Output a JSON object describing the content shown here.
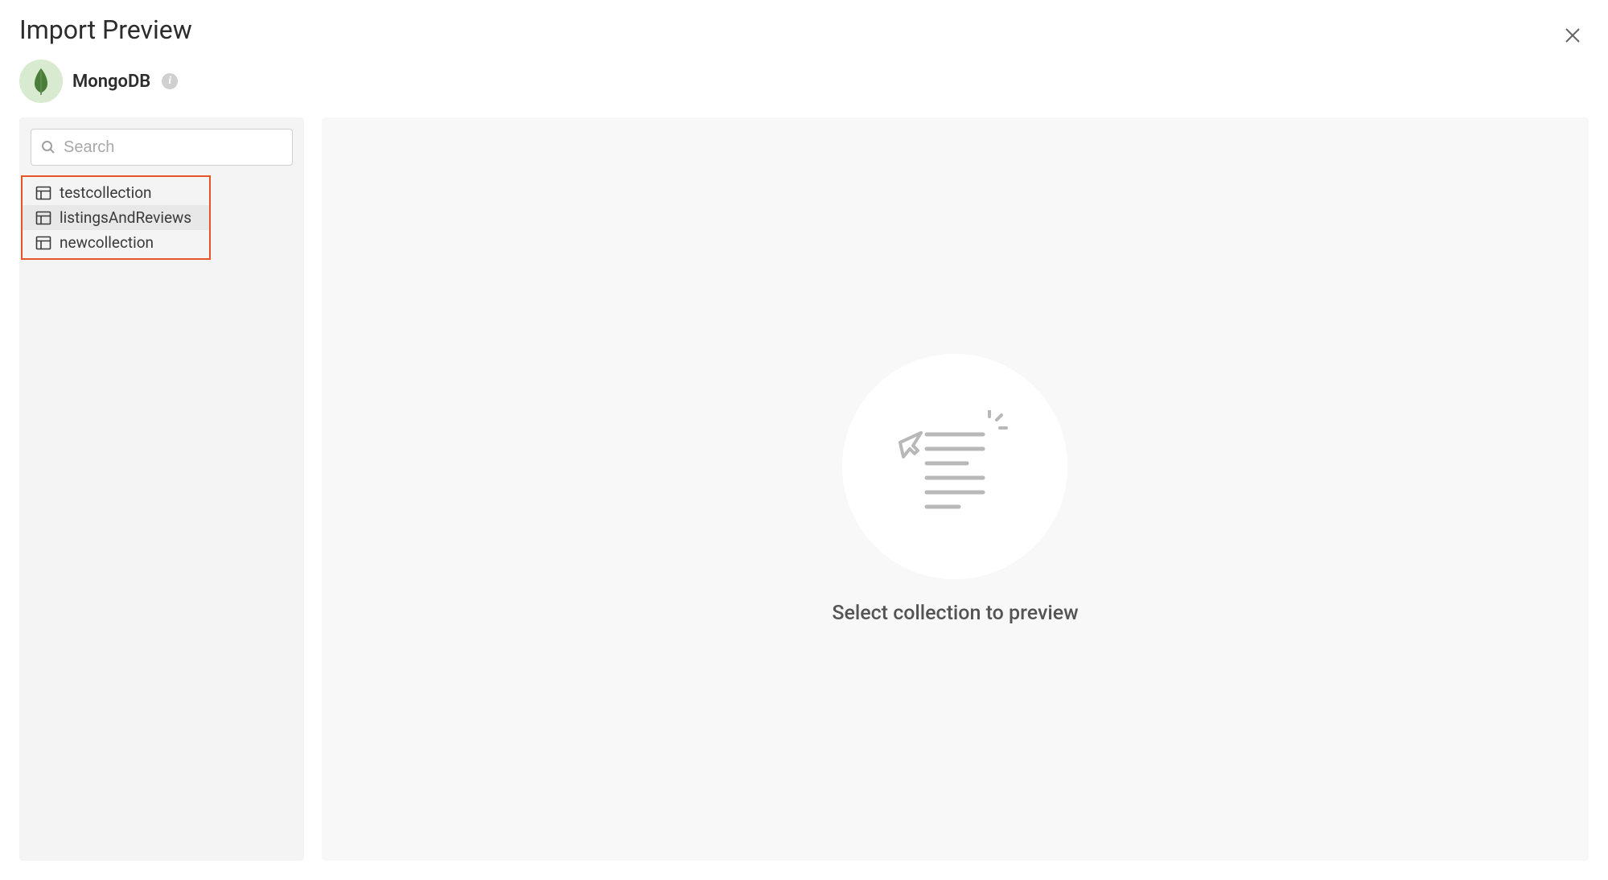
{
  "header": {
    "title": "Import Preview"
  },
  "source": {
    "name": "MongoDB"
  },
  "sidebar": {
    "search_placeholder": "Search",
    "collections": [
      {
        "label": "testcollection",
        "hovered": false
      },
      {
        "label": "listingsAndReviews",
        "hovered": true
      },
      {
        "label": "newcollection",
        "hovered": false
      }
    ]
  },
  "main": {
    "empty_message": "Select collection to preview"
  },
  "colors": {
    "highlight_border": "#e55527",
    "sidebar_bg": "#f4f4f4",
    "main_bg": "#f8f8f8",
    "source_icon_bg": "#d8ebd0"
  }
}
